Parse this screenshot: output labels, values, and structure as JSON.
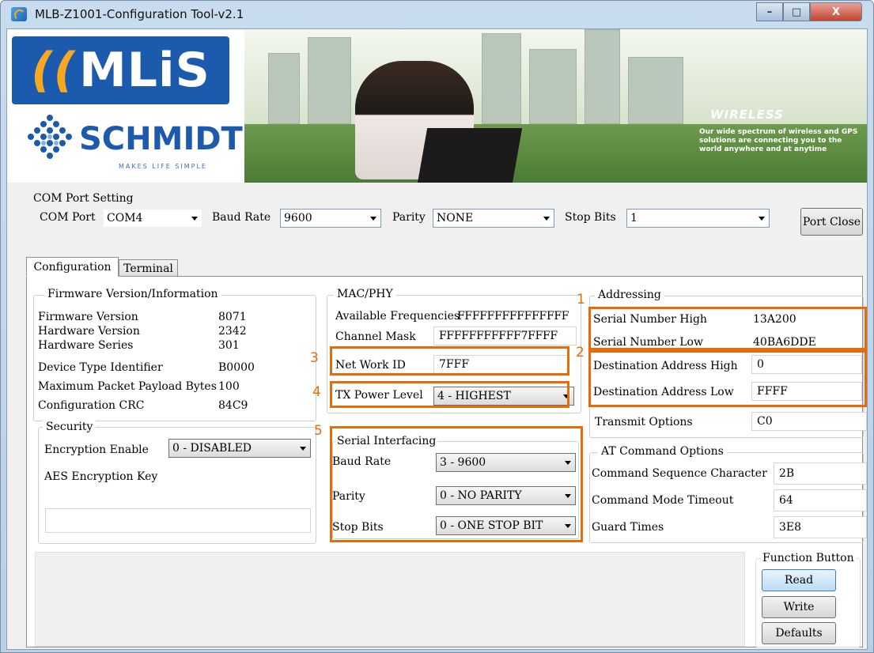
{
  "window": {
    "title": "MLB-Z1001-Configuration Tool-v2.1",
    "min": "–",
    "max": "□",
    "close": "X"
  },
  "banner": {
    "brand": "MLiS",
    "company": "SCHMIDT",
    "tagline": "MAKES LIFE SIMPLE",
    "headline": "WIRELESS",
    "subtext": "Our wide spectrum of wireless and GPS solutions are connecting you to the world anywhere and at anytime"
  },
  "com": {
    "group_label": "COM Port Setting",
    "port_label": "COM Port",
    "port_value": "COM4",
    "baud_label": "Baud Rate",
    "baud_value": "9600",
    "parity_label": "Parity",
    "parity_value": "NONE",
    "stop_label": "Stop Bits",
    "stop_value": "1",
    "close_button": "Port Close"
  },
  "tabs": [
    {
      "label": "Configuration"
    },
    {
      "label": "Terminal"
    }
  ],
  "firmware": {
    "group_label": "Firmware Version/Information",
    "rows": [
      {
        "label": "Firmware Version",
        "value": "8071"
      },
      {
        "label": "Hardware Version",
        "value": "2342"
      },
      {
        "label": "Hardware Series",
        "value": "301"
      },
      {
        "label": "Device Type Identifier",
        "value": "B0000"
      },
      {
        "label": "Maximum Packet Payload Bytes",
        "value": "100"
      },
      {
        "label": "Configuration CRC",
        "value": "84C9"
      }
    ]
  },
  "security": {
    "group_label": "Security",
    "encryption_label": "Encryption Enable",
    "encryption_value": "0 - DISABLED",
    "aes_label": "AES Encryption Key",
    "aes_value": ""
  },
  "mac": {
    "group_label": "MAC/PHY",
    "freq_label": "Available Frequencies",
    "freq_value": "FFFFFFFFFFFFFFF",
    "channel_label": "Channel Mask",
    "channel_value": "FFFFFFFFFFF7FFFF",
    "network_label": "Net Work ID",
    "network_value": "7FFF",
    "tx_label": "TX Power Level",
    "tx_value": "4 - HIGHEST"
  },
  "serial": {
    "group_label": "Serial Interfacing",
    "baud_label": "Baud Rate",
    "baud_value": "3 - 9600",
    "parity_label": "Parity",
    "parity_value": "0 - NO PARITY",
    "stop_label": "Stop Bits",
    "stop_value": "0 - ONE STOP BIT"
  },
  "addressing": {
    "group_label": "Addressing",
    "sn_high_label": "Serial Number High",
    "sn_high_value": "13A200",
    "sn_low_label": "Serial Number Low",
    "sn_low_value": "40BA6DDE",
    "dest_high_label": "Destination Address High",
    "dest_high_value": "0",
    "dest_low_label": "Destination Address Low",
    "dest_low_value": "FFFF",
    "transmit_label": "Transmit Options",
    "transmit_value": "C0"
  },
  "at": {
    "group_label": "AT Command Options",
    "seq_label": "Command Sequence Character",
    "seq_value": "2B",
    "timeout_label": "Command Mode Timeout",
    "timeout_value": "64",
    "guard_label": "Guard Times",
    "guard_value": "3E8"
  },
  "functions": {
    "group_label": "Function Button",
    "read": "Read",
    "write": "Write",
    "defaults": "Defaults"
  },
  "annotations": {
    "n1": "1",
    "n2": "2",
    "n3": "3",
    "n4": "4",
    "n5": "5"
  },
  "colors": {
    "annotation": "#e46c0a",
    "brand_blue": "#1c5aad",
    "brand_orange": "#f7a823"
  }
}
